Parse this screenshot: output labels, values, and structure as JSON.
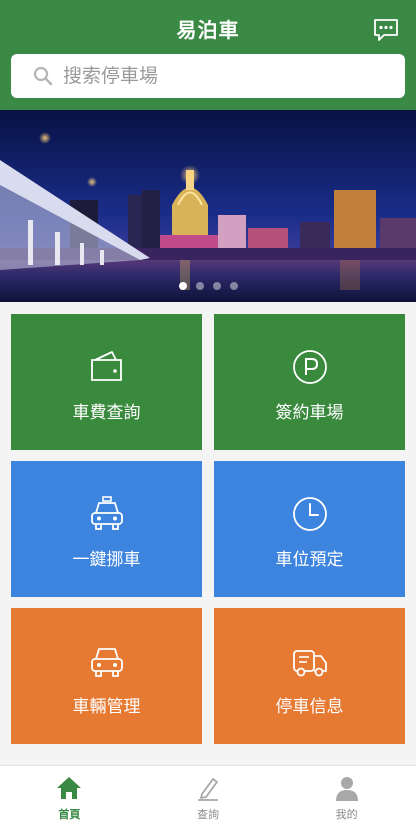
{
  "header": {
    "title": "易泊車",
    "message_icon": "chat-bubble-icon"
  },
  "search": {
    "placeholder": "搜索停車場",
    "icon": "search-icon"
  },
  "banner": {
    "image": "Macau night skyline with bridge",
    "slide_count": 4,
    "active_slide": 1
  },
  "tiles": [
    {
      "label": "車費查詢",
      "icon": "wallet-icon",
      "color": "#3a8a3e"
    },
    {
      "label": "簽約車場",
      "icon": "parking-icon",
      "color": "#3a8a3e"
    },
    {
      "label": "一鍵挪車",
      "icon": "taxi-icon",
      "color": "#3d84de"
    },
    {
      "label": "車位預定",
      "icon": "clock-icon",
      "color": "#3d84de"
    },
    {
      "label": "車輛管理",
      "icon": "car-icon",
      "color": "#e67a33"
    },
    {
      "label": "停車信息",
      "icon": "truck-info-icon",
      "color": "#e67a33"
    }
  ],
  "tabbar": {
    "items": [
      {
        "label": "首頁",
        "icon": "home-icon",
        "active": true
      },
      {
        "label": "查詢",
        "icon": "edit-icon",
        "active": false
      },
      {
        "label": "我的",
        "icon": "user-icon",
        "active": false
      }
    ],
    "active_color": "#3a8a45",
    "inactive_color": "#a8a8a8"
  }
}
